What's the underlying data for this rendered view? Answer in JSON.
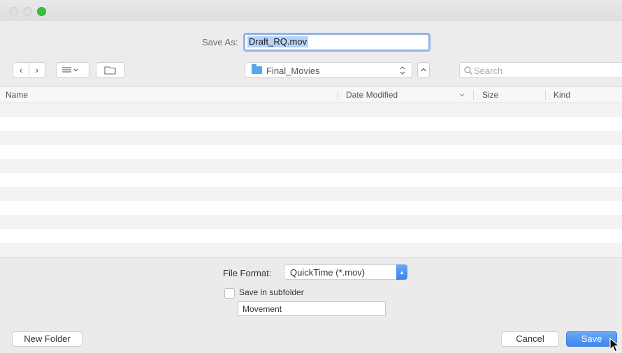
{
  "window": {
    "traffic_lights": [
      "#dedede",
      "#dedede",
      "#35c13f"
    ]
  },
  "save_as": {
    "label": "Save As:",
    "value": "Draft_RQ.mov"
  },
  "toolbar": {
    "back_icon": "chevron-left-icon",
    "forward_icon": "chevron-right-icon",
    "view_icon": "list-view-icon",
    "new_folder_icon": "folder-icon",
    "location": "Final_Movies",
    "search_placeholder": "Search"
  },
  "columns": [
    "Name",
    "Date Modified",
    "Size",
    "Kind"
  ],
  "rows": [],
  "options": {
    "file_format_label": "File Format:",
    "file_format_value": "QuickTime (*.mov)",
    "subfolder_label": "Save in subfolder",
    "subfolder_checked": false,
    "subfolder_value": "Movement"
  },
  "buttons": {
    "new_folder": "New Folder",
    "cancel": "Cancel",
    "save": "Save"
  },
  "colors": {
    "accent": "#3f86ec",
    "selection": "#b7d2f6"
  }
}
